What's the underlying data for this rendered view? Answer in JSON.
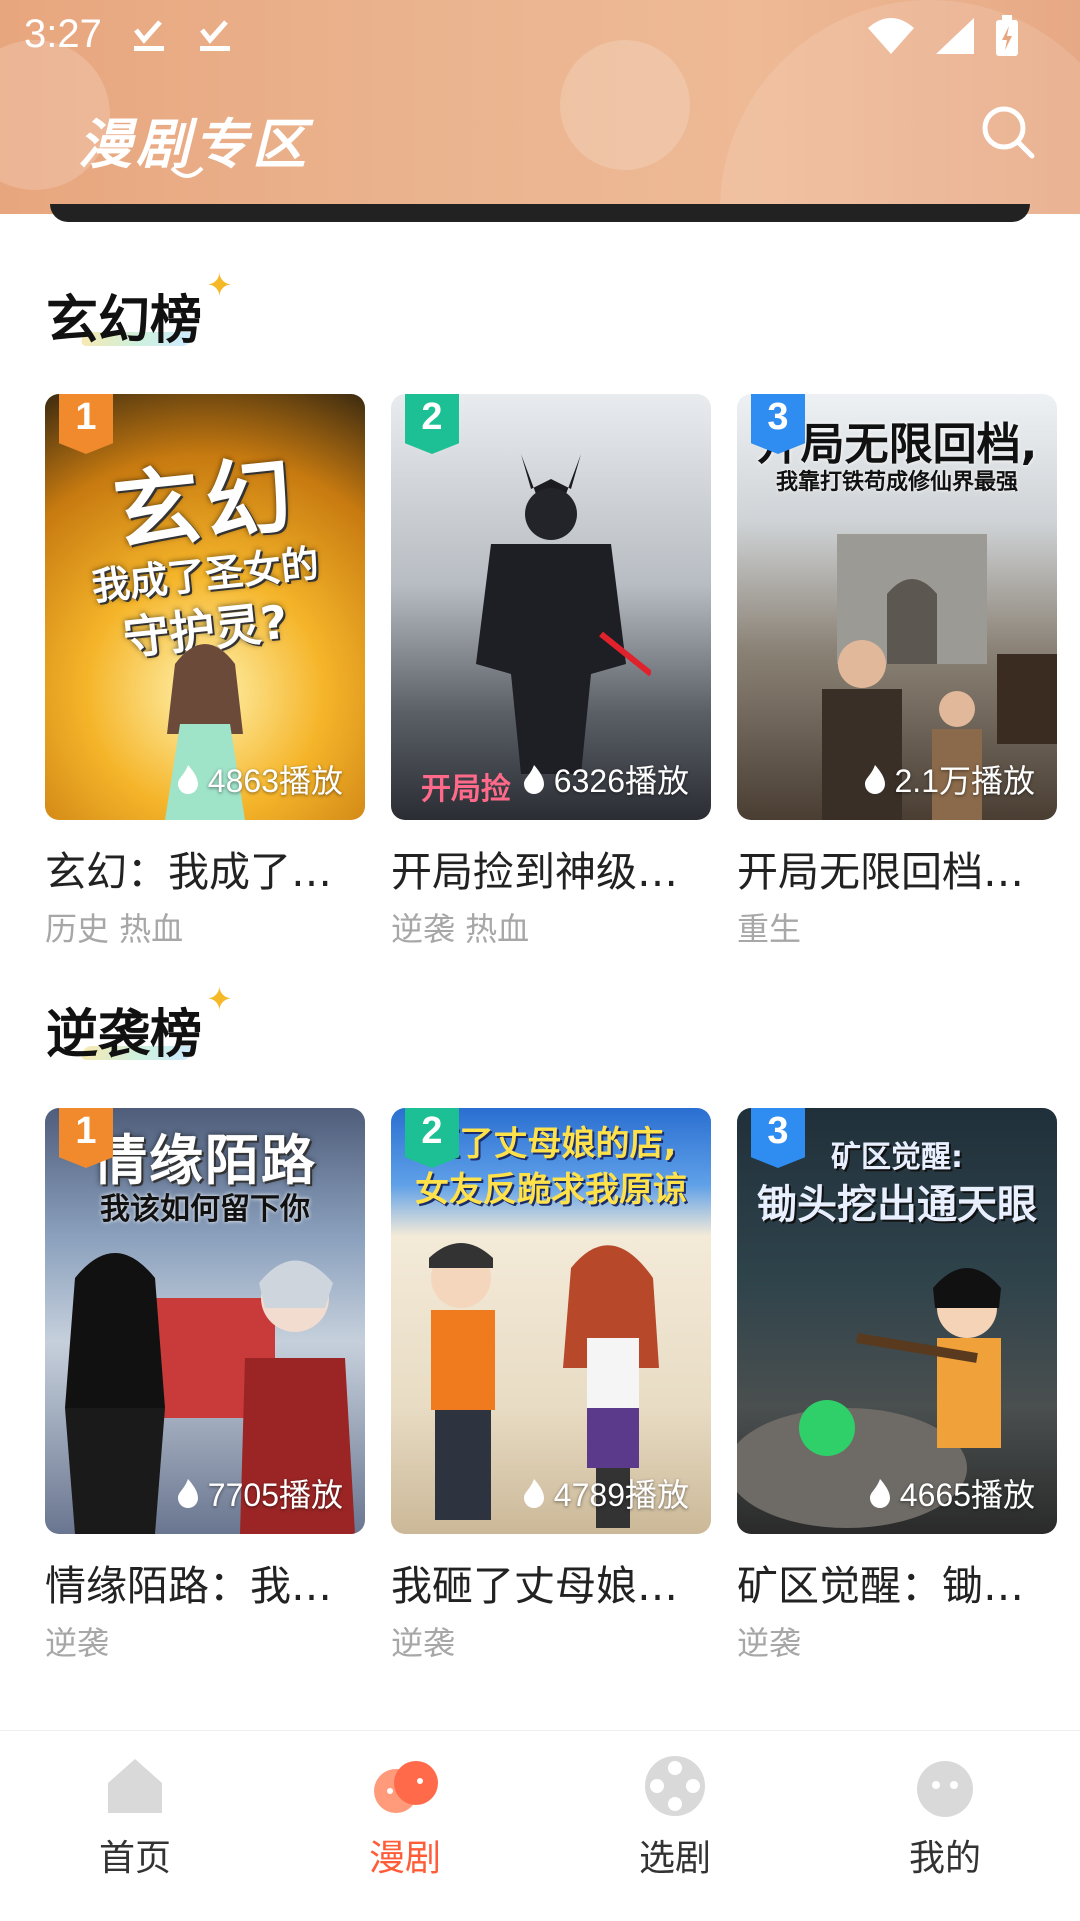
{
  "status_bar": {
    "time": "3:27"
  },
  "header": {
    "title": "漫剧专区"
  },
  "sections": [
    {
      "title": "玄幻榜",
      "cards": [
        {
          "rank": "1",
          "title": "玄幻：我成了…",
          "tags": "历史 热血",
          "plays": "4863播放",
          "cover_lines": [
            "玄幻",
            "我成了圣女的",
            "守护灵?"
          ]
        },
        {
          "rank": "2",
          "title": "开局捡到神级…",
          "tags": "逆袭 热血",
          "plays": "6326播放",
          "cover_lines": [
            "开局捡"
          ]
        },
        {
          "rank": "3",
          "title": "开局无限回档…",
          "tags": "重生",
          "plays": "2.1万播放",
          "cover_lines": [
            "开局无限回档,",
            "我靠打铁苟成修仙界最强"
          ]
        }
      ]
    },
    {
      "title": "逆袭榜",
      "cards": [
        {
          "rank": "1",
          "title": "情缘陌路：我…",
          "tags": "逆袭",
          "plays": "7705播放",
          "cover_lines": [
            "情缘陌路",
            "我该如何留下你"
          ]
        },
        {
          "rank": "2",
          "title": "我砸了丈母娘…",
          "tags": "逆袭",
          "plays": "4789播放",
          "cover_lines": [
            "砸了丈母娘的店,",
            "女友反跪求我原谅"
          ]
        },
        {
          "rank": "3",
          "title": "矿区觉醒：锄…",
          "tags": "逆袭",
          "plays": "4665播放",
          "cover_lines": [
            "矿区觉醒:",
            "锄头挖出通天眼"
          ]
        }
      ]
    }
  ],
  "bottom_nav": [
    {
      "label": "首页",
      "icon": "home-icon",
      "active": false
    },
    {
      "label": "漫剧",
      "icon": "drama-icon",
      "active": true
    },
    {
      "label": "选剧",
      "icon": "film-reel-icon",
      "active": false
    },
    {
      "label": "我的",
      "icon": "profile-icon",
      "active": false
    }
  ],
  "colors": {
    "accent": "#ff5c38",
    "header_start": "#e8a67e",
    "header_end": "#eeb995"
  }
}
